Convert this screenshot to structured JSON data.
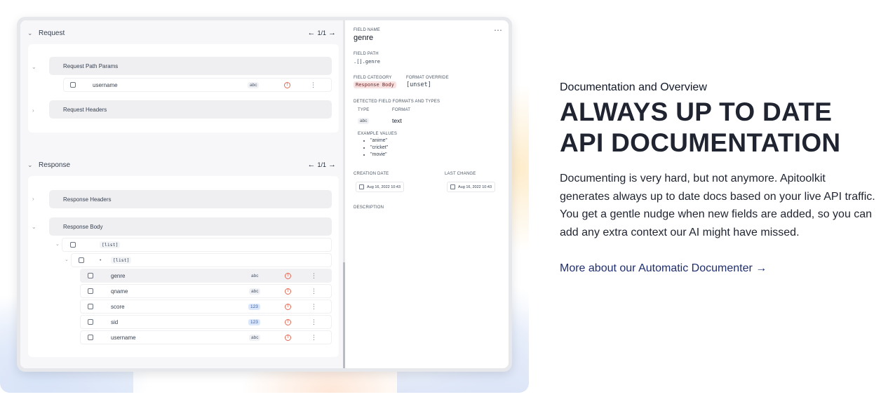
{
  "request": {
    "title": "Request",
    "pager": {
      "prev": "←",
      "text": "1/1",
      "next": "→"
    },
    "groups": {
      "path_params": "Request Path Params",
      "headers": "Request Headers"
    },
    "path_rows": [
      {
        "name": "username",
        "type": "abc"
      }
    ]
  },
  "response": {
    "title": "Response",
    "pager": {
      "prev": "←",
      "text": "1/1",
      "next": "→"
    },
    "groups": {
      "headers": "Response Headers",
      "body": "Response Body"
    },
    "list_outer": "[list]",
    "list_inner": "[list]",
    "fields": [
      {
        "name": "genre",
        "type": "abc"
      },
      {
        "name": "qname",
        "type": "abc"
      },
      {
        "name": "score",
        "type": "123"
      },
      {
        "name": "sid",
        "type": "123"
      },
      {
        "name": "username",
        "type": "abc"
      }
    ]
  },
  "detail": {
    "more_icon": "⋯",
    "field_name_label": "Field Name",
    "field_name": "genre",
    "field_path_label": "Field Path",
    "field_path": ".[].genre",
    "category_label": "Field Category",
    "category": "Response Body",
    "format_override_label": "Format Override",
    "format_override": "[unset]",
    "detected_label": "Detected Field Formats and Types",
    "type_label": "Type",
    "format_label": "Format",
    "type": "abc",
    "format": "text",
    "examples_label": "Example Values",
    "examples": [
      "\"anime\"",
      "\"cricket\"",
      "\"movie\""
    ],
    "creation_label": "Creation Date",
    "creation_date": "Aug 16, 2022 10:43",
    "last_change_label": "Last Change",
    "last_change_date": "Aug 16, 2022 10:43",
    "description_label": "Description"
  },
  "marketing": {
    "eyebrow": "Documentation and Overview",
    "headline_1": "ALWAYS UP TO DATE",
    "headline_2": "API DOCUMENTATION",
    "body": "Documenting is very hard, but not anymore. Apitoolkit generates always up to date docs based on your live API traffic. You get a gentle nudge when new fields are added, so you can add any extra context our AI might have missed.",
    "link": "More about our Automatic Documenter →"
  },
  "colors": {
    "warning": "#e66a55",
    "link": "#1f2e6f",
    "category_pill": "#f8e1e1",
    "numeric_badge": "#dbe7fb"
  }
}
